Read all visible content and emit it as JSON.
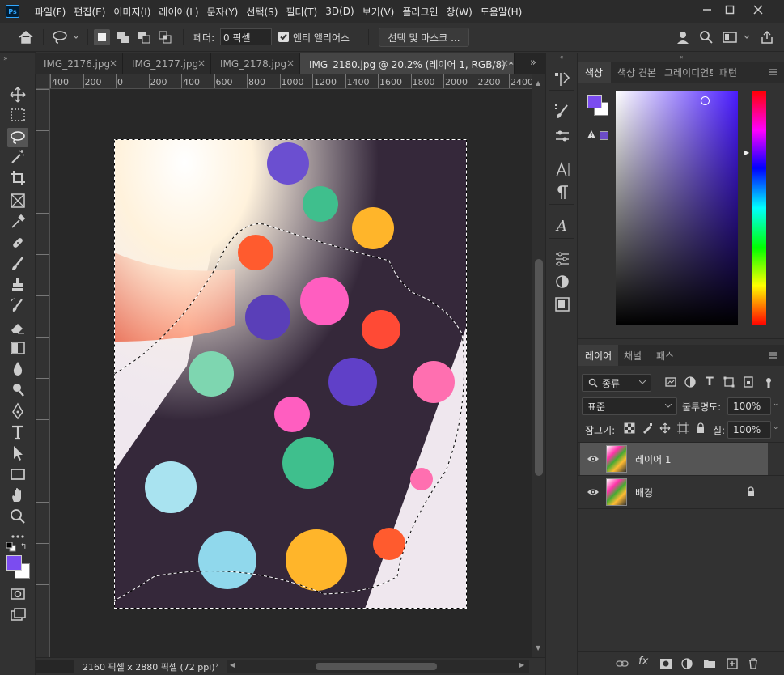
{
  "app": {
    "logo": "Ps"
  },
  "menu": [
    "파일(F)",
    "편집(E)",
    "이미지(I)",
    "레이어(L)",
    "문자(Y)",
    "선택(S)",
    "필터(T)",
    "3D(D)",
    "보기(V)",
    "플러그인",
    "창(W)",
    "도움말(H)"
  ],
  "options": {
    "feather_label": "페더:",
    "feather_value": "0 픽셀",
    "antialias_label": "앤티 앨리어스",
    "antialias_checked": true,
    "select_mask_button": "선택 및 마스크 ..."
  },
  "tabs": [
    {
      "label": "IMG_2176.jpg",
      "active": false
    },
    {
      "label": "IMG_2177.jpg",
      "active": false
    },
    {
      "label": "IMG_2178.jpg",
      "active": false
    },
    {
      "label": "IMG_2180.jpg @ 20.2% (레이어 1, RGB/8) *",
      "active": true
    }
  ],
  "tabs_overflow": "»",
  "ruler_top": [
    "400",
    "200",
    "0",
    "200",
    "400",
    "600",
    "800",
    "1000",
    "1200",
    "1400",
    "1600",
    "1800",
    "2000",
    "2200",
    "2400"
  ],
  "status": {
    "dimensions": "2160 픽셀 x 2880 픽셀 (72 ppi)"
  },
  "color_panel": {
    "tabs": [
      "색상",
      "색상 견본",
      "그레이디언트",
      "패턴"
    ],
    "foreground": "#7b4cf0",
    "background": "#ffffff",
    "hue_color": "#4a1cff"
  },
  "layers_panel": {
    "tabs": [
      "레이어",
      "채널",
      "패스"
    ],
    "filter_kind": "종류",
    "blend_mode": "표준",
    "opacity_label": "불투명도:",
    "opacity_value": "100%",
    "lock_label": "잠그기:",
    "fill_label": "칠:",
    "fill_value": "100%",
    "layers": [
      {
        "name": "레이어 1",
        "selected": true,
        "locked": false
      },
      {
        "name": "배경",
        "selected": false,
        "locked": true
      }
    ]
  }
}
